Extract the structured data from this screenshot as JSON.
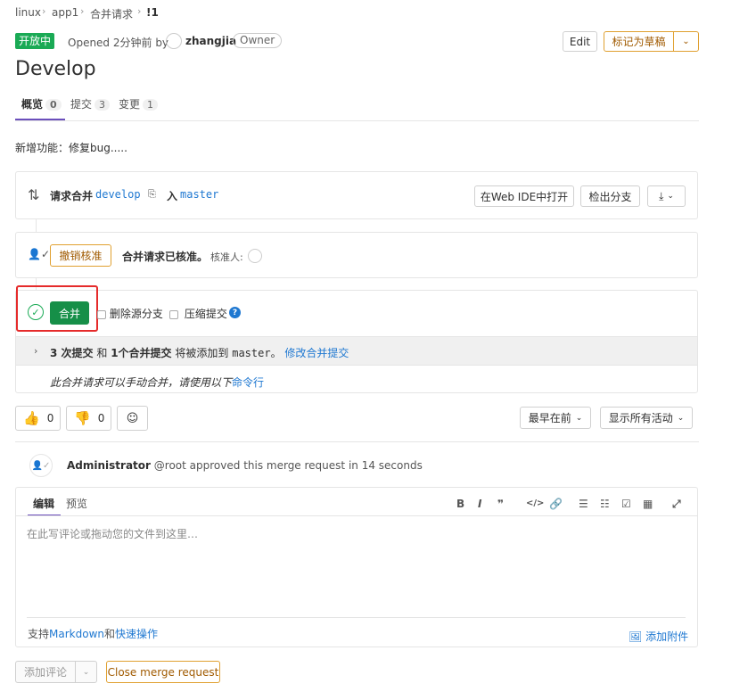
{
  "breadcrumb": [
    "linux",
    "app1",
    "合并请求",
    "!1"
  ],
  "header": {
    "status": "开放中",
    "opened_text": "Opened 2分钟前 by",
    "author": "zhangjia",
    "role": "Owner",
    "edit_label": "Edit",
    "draft_label": "标记为草稿",
    "title": "Develop"
  },
  "tabs": [
    {
      "label": "概览",
      "count": "0"
    },
    {
      "label": "提交",
      "count": "3"
    },
    {
      "label": "变更",
      "count": "1"
    }
  ],
  "description": "新增功能：修复bug.....",
  "merge_info": {
    "prefix": "请求合并",
    "source": "develop",
    "into": "入",
    "target": "master",
    "webide_label": "在Web IDE中打开",
    "checkout_label": "检出分支"
  },
  "approval": {
    "revoke_label": "撤销核准",
    "approved_text": "合并请求已核准。",
    "approver_label": "核准人:"
  },
  "merge_box": {
    "merge_label": "合并",
    "delete_source": "删除源分支",
    "squash": "压缩提交",
    "help": "?",
    "commits_bold": "3 次提交",
    "and_text": "和",
    "merge_commit_bold": "1个合并提交",
    "will_add": "将被添加到",
    "target": "master。",
    "modify_link": "修改合并提交",
    "manual_text": "此合并请求可以手动合并，请使用以下",
    "cmd_link": "命令行"
  },
  "reactions": {
    "thumbs_up_count": "0",
    "thumbs_down_count": "0"
  },
  "sort": {
    "sort_label": "最早在前",
    "filter_label": "显示所有活动"
  },
  "activity": {
    "user": "Administrator",
    "handle": "@root",
    "text": "approved this merge request in 14 seconds"
  },
  "editor": {
    "tab_write": "编辑",
    "tab_preview": "预览",
    "placeholder": "在此写评论或拖动您的文件到这里…",
    "support_prefix": "支持",
    "markdown_link": "Markdown",
    "and": "和",
    "quick_link": "快速操作",
    "attach_label": "添加附件",
    "toolbar": [
      "B",
      "I",
      "99",
      "</>",
      "link",
      "ul",
      "ol",
      "task",
      "table",
      "expand"
    ]
  },
  "footer": {
    "comment_label": "添加评论",
    "close_label": "Close merge request"
  },
  "colors": {
    "success": "#1aaa55",
    "merge_green": "#168f48",
    "link": "#1f78d1",
    "highlight": "#e52b2b",
    "warning": "#e0a030"
  }
}
